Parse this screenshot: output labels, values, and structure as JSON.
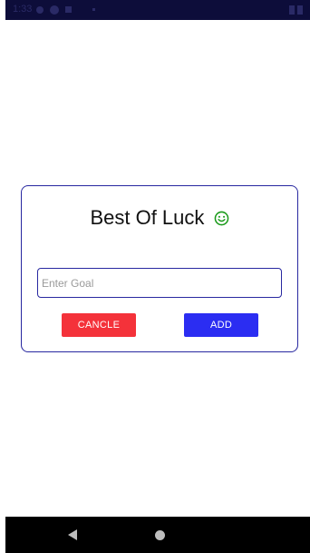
{
  "status_bar": {
    "time": "1:33"
  },
  "dialog": {
    "title": "Best Of Luck",
    "title_icon": "smile-icon",
    "input": {
      "value": "",
      "placeholder": "Enter Goal"
    },
    "cancel_label": "CANCLE",
    "add_label": "ADD"
  },
  "colors": {
    "cancel_button": "#f4323a",
    "add_button": "#2b2df2",
    "border": "#2828a0",
    "smile_icon": "#1a9a1a"
  },
  "nav_bar": {
    "back_icon": "back-triangle-icon",
    "home_icon": "home-circle-icon"
  }
}
